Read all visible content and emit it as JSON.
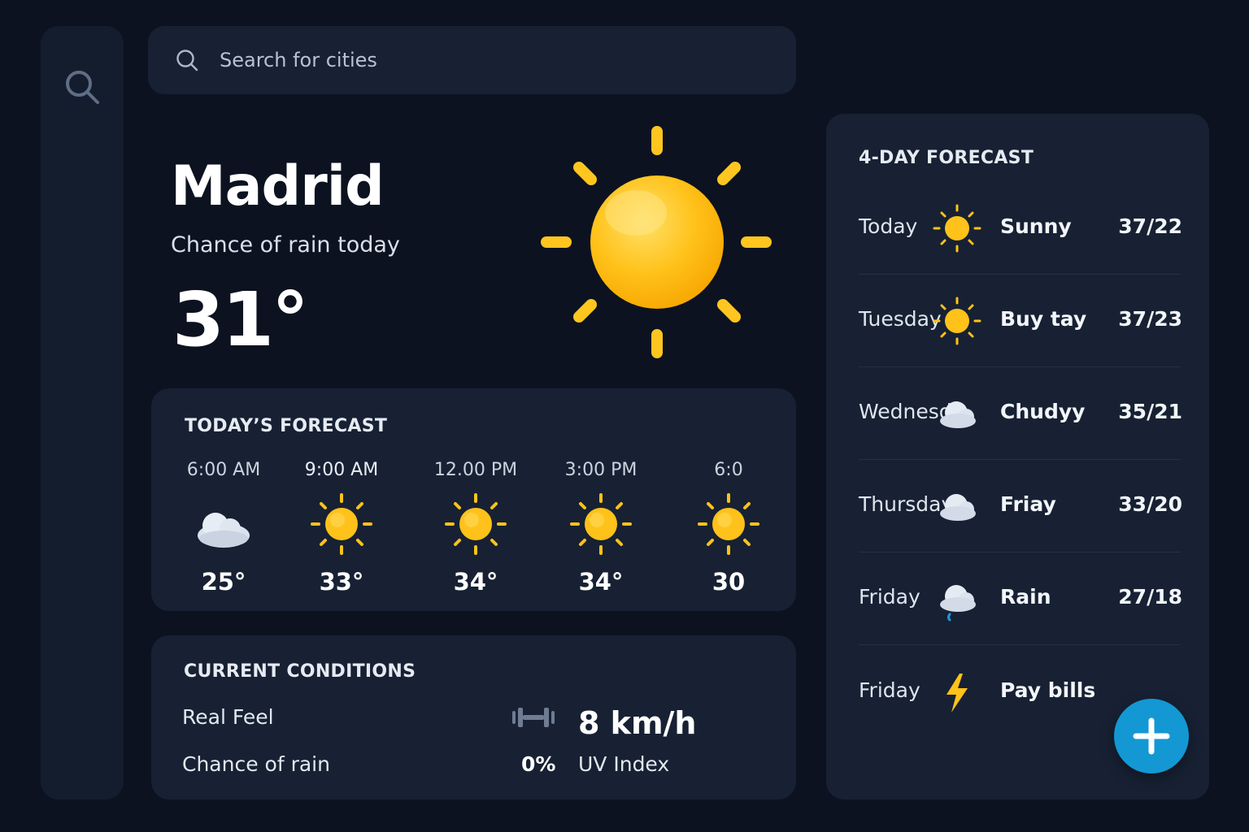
{
  "search": {
    "placeholder": "Search for cities"
  },
  "current": {
    "city": "Madrid",
    "subtitle": "Chance of rain today",
    "temperature": "31°",
    "icon": "sun-icon"
  },
  "today_forecast": {
    "title": "TODAY’S FORECAST",
    "hours": [
      {
        "time": "6:00 AM",
        "icon": "cloud-icon",
        "temp": "25°"
      },
      {
        "time": "9:00 AM",
        "icon": "sun-icon",
        "temp": "33°"
      },
      {
        "time": "12.00 PM",
        "icon": "sun-icon",
        "temp": "34°"
      },
      {
        "time": "3:00 PM",
        "icon": "sun-icon",
        "temp": "34°"
      },
      {
        "time": "6:0",
        "icon": "sun-icon",
        "temp": "30"
      }
    ]
  },
  "conditions": {
    "title": "CURRENT CONDITIONS",
    "real_feel_label": "Real Feel",
    "chance_of_rain_label": "Chance of rain",
    "wind_value": "8 km/h",
    "rain_value": "0%",
    "uv_label": "UV Index"
  },
  "four_day": {
    "title": "4-DAY FORECAST",
    "days": [
      {
        "day": "Today",
        "icon": "sun-icon",
        "condition": "Sunny",
        "range": "37/22"
      },
      {
        "day": "Tuesday",
        "icon": "sun-icon",
        "condition": "Buy tay",
        "range": "37/23"
      },
      {
        "day": "Wednesd",
        "icon": "cloud-icon",
        "condition": "Chudyy",
        "range": "35/21"
      },
      {
        "day": "Thursday",
        "icon": "cloud-icon",
        "condition": "Friay",
        "range": "33/20"
      },
      {
        "day": "Friday",
        "icon": "rain-icon",
        "condition": "Rain",
        "range": "27/18"
      },
      {
        "day": "Friday",
        "icon": "lightning-icon",
        "condition": "Pay bills",
        "range": ""
      }
    ]
  },
  "colors": {
    "accent": "#1398d4",
    "sun": "#ffc21a",
    "card": "#172133",
    "background": "#0c1220"
  }
}
